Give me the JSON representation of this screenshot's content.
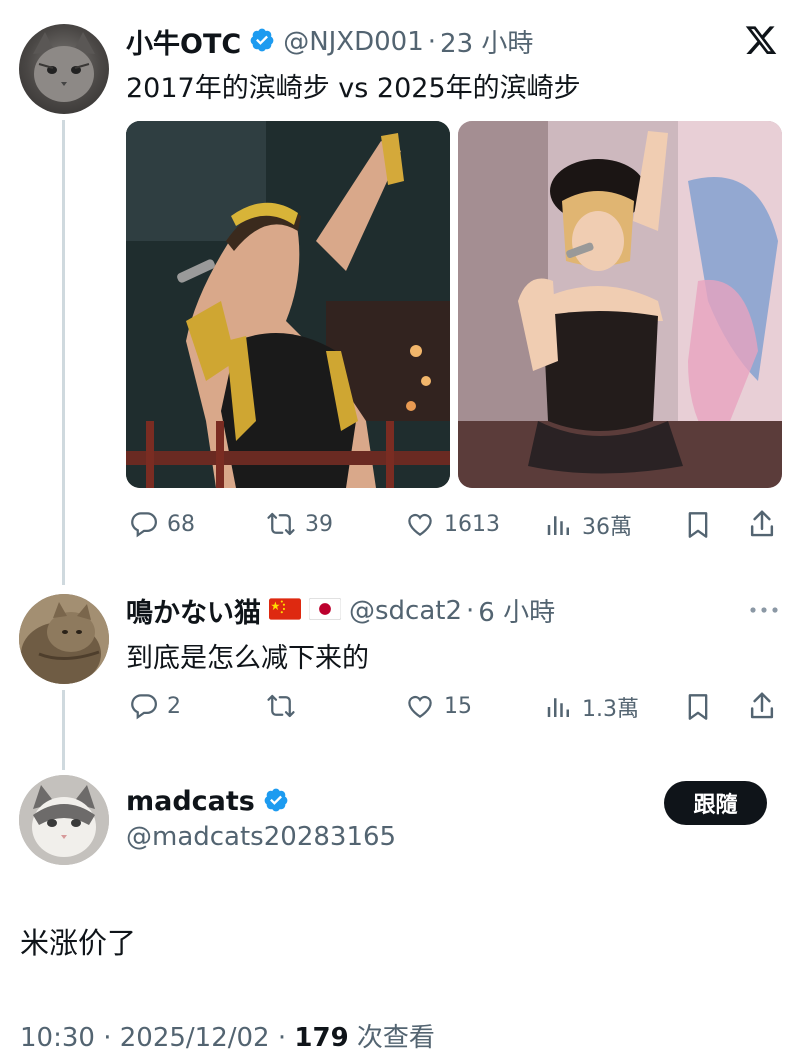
{
  "tweet1": {
    "display_name": "小牛OTC",
    "handle": "@NJXD001",
    "separator": "·",
    "time": "23 小時",
    "text": "2017年的滨崎步 vs  2025年的滨崎步",
    "stats": {
      "replies": "68",
      "retweets": "39",
      "likes": "1613",
      "views": "36萬"
    }
  },
  "tweet2": {
    "display_name": "鳴かない猫",
    "handle": "@sdcat2",
    "separator": "·",
    "time": "6 小時",
    "text": "到底是怎么减下来的",
    "stats": {
      "replies": "2",
      "likes": "15",
      "views": "1.3萬"
    }
  },
  "tweet3": {
    "display_name": "madcats",
    "handle": "@madcats20283165",
    "follow_label": "跟隨",
    "text": "米涨价了",
    "footer": {
      "time": "10:30",
      "separator1": "·",
      "date": "2025/12/02",
      "separator2": "·",
      "views_count": "179",
      "views_label": " 次查看"
    }
  },
  "icons": {
    "x_logo": "x-logo-icon",
    "verified": "verified-badge-icon",
    "reply": "reply-icon",
    "retweet": "retweet-icon",
    "like": "heart-icon",
    "views": "views-bar-icon",
    "bookmark": "bookmark-icon",
    "share": "share-icon",
    "more": "more-dots-icon"
  },
  "colors": {
    "verified_blue": "#1d9bf0",
    "muted": "#536471",
    "text": "#0f1419",
    "thread_line": "#cfd9de"
  }
}
